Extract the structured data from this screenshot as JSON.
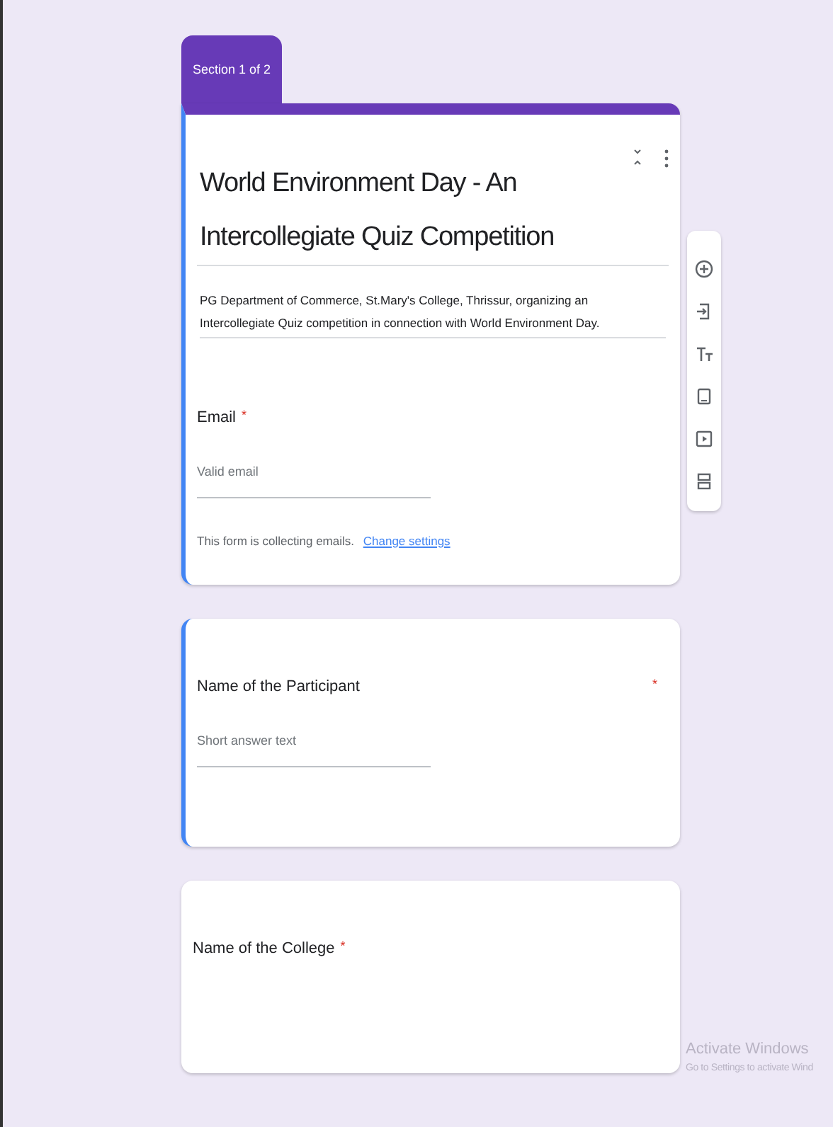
{
  "section_tab": "Section 1 of 2",
  "header": {
    "title": "World Environment Day - An Intercollegiate Quiz Competition",
    "description": "PG Department of Commerce, St.Mary's College, Thrissur, organizing an Intercollegiate Quiz competition in connection with World Environment Day.",
    "highlighted": true
  },
  "email": {
    "label": "Email",
    "required_mark": "*",
    "placeholder": "Valid email",
    "note": "This form is collecting emails.",
    "link": "Change settings"
  },
  "toolbar": [
    {
      "kind": "add"
    },
    {
      "kind": "import"
    },
    {
      "kind": "text"
    },
    {
      "kind": "image"
    },
    {
      "kind": "video"
    },
    {
      "kind": "section"
    }
  ],
  "questions": [
    {
      "label": "Name of the Participant",
      "required_mark": "*",
      "mark_far_right": true,
      "placeholder": "Short answer text",
      "highlighted": true
    },
    {
      "label": "Name of the College",
      "required_mark": "*",
      "mark_far_right": false,
      "highlighted": false
    }
  ],
  "watermark": {
    "title": "Activate Windows",
    "subtitle": "Go to Settings to activate Wind"
  }
}
